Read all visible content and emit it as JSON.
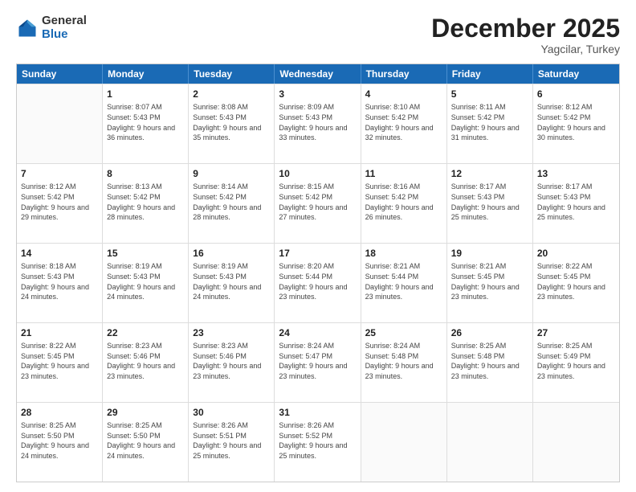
{
  "logo": {
    "general": "General",
    "blue": "Blue"
  },
  "title": "December 2025",
  "subtitle": "Yagcilar, Turkey",
  "header_days": [
    "Sunday",
    "Monday",
    "Tuesday",
    "Wednesday",
    "Thursday",
    "Friday",
    "Saturday"
  ],
  "weeks": [
    [
      {
        "day": "",
        "sunrise": "",
        "sunset": "",
        "daylight": ""
      },
      {
        "day": "1",
        "sunrise": "Sunrise: 8:07 AM",
        "sunset": "Sunset: 5:43 PM",
        "daylight": "Daylight: 9 hours and 36 minutes."
      },
      {
        "day": "2",
        "sunrise": "Sunrise: 8:08 AM",
        "sunset": "Sunset: 5:43 PM",
        "daylight": "Daylight: 9 hours and 35 minutes."
      },
      {
        "day": "3",
        "sunrise": "Sunrise: 8:09 AM",
        "sunset": "Sunset: 5:43 PM",
        "daylight": "Daylight: 9 hours and 33 minutes."
      },
      {
        "day": "4",
        "sunrise": "Sunrise: 8:10 AM",
        "sunset": "Sunset: 5:42 PM",
        "daylight": "Daylight: 9 hours and 32 minutes."
      },
      {
        "day": "5",
        "sunrise": "Sunrise: 8:11 AM",
        "sunset": "Sunset: 5:42 PM",
        "daylight": "Daylight: 9 hours and 31 minutes."
      },
      {
        "day": "6",
        "sunrise": "Sunrise: 8:12 AM",
        "sunset": "Sunset: 5:42 PM",
        "daylight": "Daylight: 9 hours and 30 minutes."
      }
    ],
    [
      {
        "day": "7",
        "sunrise": "Sunrise: 8:12 AM",
        "sunset": "Sunset: 5:42 PM",
        "daylight": "Daylight: 9 hours and 29 minutes."
      },
      {
        "day": "8",
        "sunrise": "Sunrise: 8:13 AM",
        "sunset": "Sunset: 5:42 PM",
        "daylight": "Daylight: 9 hours and 28 minutes."
      },
      {
        "day": "9",
        "sunrise": "Sunrise: 8:14 AM",
        "sunset": "Sunset: 5:42 PM",
        "daylight": "Daylight: 9 hours and 28 minutes."
      },
      {
        "day": "10",
        "sunrise": "Sunrise: 8:15 AM",
        "sunset": "Sunset: 5:42 PM",
        "daylight": "Daylight: 9 hours and 27 minutes."
      },
      {
        "day": "11",
        "sunrise": "Sunrise: 8:16 AM",
        "sunset": "Sunset: 5:42 PM",
        "daylight": "Daylight: 9 hours and 26 minutes."
      },
      {
        "day": "12",
        "sunrise": "Sunrise: 8:17 AM",
        "sunset": "Sunset: 5:43 PM",
        "daylight": "Daylight: 9 hours and 25 minutes."
      },
      {
        "day": "13",
        "sunrise": "Sunrise: 8:17 AM",
        "sunset": "Sunset: 5:43 PM",
        "daylight": "Daylight: 9 hours and 25 minutes."
      }
    ],
    [
      {
        "day": "14",
        "sunrise": "Sunrise: 8:18 AM",
        "sunset": "Sunset: 5:43 PM",
        "daylight": "Daylight: 9 hours and 24 minutes."
      },
      {
        "day": "15",
        "sunrise": "Sunrise: 8:19 AM",
        "sunset": "Sunset: 5:43 PM",
        "daylight": "Daylight: 9 hours and 24 minutes."
      },
      {
        "day": "16",
        "sunrise": "Sunrise: 8:19 AM",
        "sunset": "Sunset: 5:43 PM",
        "daylight": "Daylight: 9 hours and 24 minutes."
      },
      {
        "day": "17",
        "sunrise": "Sunrise: 8:20 AM",
        "sunset": "Sunset: 5:44 PM",
        "daylight": "Daylight: 9 hours and 23 minutes."
      },
      {
        "day": "18",
        "sunrise": "Sunrise: 8:21 AM",
        "sunset": "Sunset: 5:44 PM",
        "daylight": "Daylight: 9 hours and 23 minutes."
      },
      {
        "day": "19",
        "sunrise": "Sunrise: 8:21 AM",
        "sunset": "Sunset: 5:45 PM",
        "daylight": "Daylight: 9 hours and 23 minutes."
      },
      {
        "day": "20",
        "sunrise": "Sunrise: 8:22 AM",
        "sunset": "Sunset: 5:45 PM",
        "daylight": "Daylight: 9 hours and 23 minutes."
      }
    ],
    [
      {
        "day": "21",
        "sunrise": "Sunrise: 8:22 AM",
        "sunset": "Sunset: 5:45 PM",
        "daylight": "Daylight: 9 hours and 23 minutes."
      },
      {
        "day": "22",
        "sunrise": "Sunrise: 8:23 AM",
        "sunset": "Sunset: 5:46 PM",
        "daylight": "Daylight: 9 hours and 23 minutes."
      },
      {
        "day": "23",
        "sunrise": "Sunrise: 8:23 AM",
        "sunset": "Sunset: 5:46 PM",
        "daylight": "Daylight: 9 hours and 23 minutes."
      },
      {
        "day": "24",
        "sunrise": "Sunrise: 8:24 AM",
        "sunset": "Sunset: 5:47 PM",
        "daylight": "Daylight: 9 hours and 23 minutes."
      },
      {
        "day": "25",
        "sunrise": "Sunrise: 8:24 AM",
        "sunset": "Sunset: 5:48 PM",
        "daylight": "Daylight: 9 hours and 23 minutes."
      },
      {
        "day": "26",
        "sunrise": "Sunrise: 8:25 AM",
        "sunset": "Sunset: 5:48 PM",
        "daylight": "Daylight: 9 hours and 23 minutes."
      },
      {
        "day": "27",
        "sunrise": "Sunrise: 8:25 AM",
        "sunset": "Sunset: 5:49 PM",
        "daylight": "Daylight: 9 hours and 23 minutes."
      }
    ],
    [
      {
        "day": "28",
        "sunrise": "Sunrise: 8:25 AM",
        "sunset": "Sunset: 5:50 PM",
        "daylight": "Daylight: 9 hours and 24 minutes."
      },
      {
        "day": "29",
        "sunrise": "Sunrise: 8:25 AM",
        "sunset": "Sunset: 5:50 PM",
        "daylight": "Daylight: 9 hours and 24 minutes."
      },
      {
        "day": "30",
        "sunrise": "Sunrise: 8:26 AM",
        "sunset": "Sunset: 5:51 PM",
        "daylight": "Daylight: 9 hours and 25 minutes."
      },
      {
        "day": "31",
        "sunrise": "Sunrise: 8:26 AM",
        "sunset": "Sunset: 5:52 PM",
        "daylight": "Daylight: 9 hours and 25 minutes."
      },
      {
        "day": "",
        "sunrise": "",
        "sunset": "",
        "daylight": ""
      },
      {
        "day": "",
        "sunrise": "",
        "sunset": "",
        "daylight": ""
      },
      {
        "day": "",
        "sunrise": "",
        "sunset": "",
        "daylight": ""
      }
    ]
  ]
}
